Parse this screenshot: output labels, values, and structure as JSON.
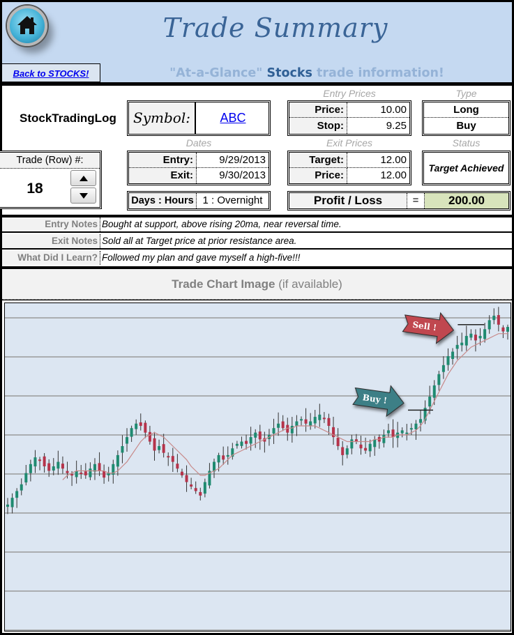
{
  "header": {
    "title": "Trade Summary",
    "back_link": "Back to STOCKS!",
    "subtitle_part1": "\"At-a-Glance\" ",
    "subtitle_part2": "Stocks",
    "subtitle_part3": " trade information!",
    "home_icon": "home-icon"
  },
  "brand": "StockTradingLog",
  "trade_row": {
    "label": "Trade (Row) #:",
    "value": "18",
    "up_icon": "triangle-up-icon",
    "down_icon": "triangle-down-icon"
  },
  "symbol": {
    "label": "Symbol:",
    "value": "ABC"
  },
  "dates": {
    "heading": "Dates",
    "entry_label": "Entry:",
    "entry_value": "9/29/2013",
    "exit_label": "Exit:",
    "exit_value": "9/30/2013"
  },
  "duration": {
    "label": "Days : Hours",
    "value": "1 : Overnight"
  },
  "entry_prices": {
    "heading": "Entry Prices",
    "price_label": "Price:",
    "price_value": "10.00",
    "stop_label": "Stop:",
    "stop_value": "9.25"
  },
  "exit_prices": {
    "heading": "Exit Prices",
    "target_label": "Target:",
    "target_value": "12.00",
    "price_label": "Price:",
    "price_value": "12.00"
  },
  "type": {
    "heading": "Type",
    "direction": "Long",
    "action": "Buy"
  },
  "status": {
    "heading": "Status",
    "value": "Target Achieved"
  },
  "profit_loss": {
    "label": "Profit / Loss",
    "equals": "=",
    "value": "200.00"
  },
  "notes": [
    {
      "label": "Entry Notes",
      "value": "Bought at support, above rising 20ma, near reversal time."
    },
    {
      "label": "Exit Notes",
      "value": "Sold all at Target price at prior resistance area."
    },
    {
      "label": "What Did I Learn?",
      "value": "Followed my plan and gave myself a high-five!!!"
    }
  ],
  "chart_section": {
    "title_bold": "Trade Chart Image",
    "title_rest": " (if available)"
  },
  "colors": {
    "header_bg": "#c5d9f1",
    "profit_bg": "#d8e4bc",
    "chart_bg": "#dce6f2",
    "candle_up": "#1f8a70",
    "candle_down": "#b5334a",
    "ma_line": "#c88a8a",
    "buy_arrow": "#3d7f86",
    "sell_arrow": "#c0474f"
  },
  "chart_annotations": {
    "buy_label": "Buy !",
    "sell_label": "Sell !"
  },
  "chart_data": {
    "type": "candlestick",
    "title": "",
    "xlabel": "",
    "ylabel": "",
    "gridlines": 9,
    "close_path": [
      20,
      23,
      26,
      29,
      34,
      38,
      41,
      40,
      37,
      35,
      37,
      39,
      36,
      34,
      33,
      35,
      34,
      33,
      36,
      38,
      35,
      32,
      34,
      38,
      42,
      46,
      50,
      54,
      56,
      55,
      52,
      48,
      44,
      46,
      43,
      41,
      39,
      36,
      33,
      30,
      28,
      26,
      24,
      30,
      35,
      39,
      42,
      40,
      42,
      45,
      47,
      48,
      47,
      50,
      52,
      49,
      48,
      51,
      54,
      56,
      54,
      52,
      55,
      57,
      58,
      56,
      57,
      59,
      60,
      58,
      55,
      50,
      46,
      42,
      45,
      49,
      48,
      45,
      44,
      47,
      49,
      48,
      51,
      53,
      50,
      52,
      53,
      52,
      54,
      56,
      58,
      63,
      68,
      73,
      78,
      82,
      86,
      88,
      91,
      92,
      95,
      96,
      93,
      95,
      98,
      102,
      104,
      100,
      97,
      99
    ],
    "ma_path": [
      null,
      null,
      null,
      null,
      null,
      null,
      null,
      null,
      null,
      null,
      null,
      null,
      31,
      33,
      34,
      35,
      35,
      35,
      35,
      35,
      35,
      35,
      34,
      34,
      35,
      37,
      39,
      42,
      45,
      48,
      50,
      51,
      52,
      51,
      50,
      48,
      46,
      44,
      42,
      40,
      37,
      35,
      33,
      33,
      34,
      35,
      36,
      38,
      40,
      42,
      43,
      44,
      45,
      46,
      47,
      48,
      49,
      50,
      51,
      52,
      53,
      54,
      54,
      55,
      55,
      55,
      55,
      55,
      54,
      53,
      52,
      51,
      50,
      49,
      48,
      48,
      48,
      48,
      48,
      48,
      49,
      49,
      50,
      50,
      50,
      51,
      51,
      51,
      52,
      53,
      55,
      58,
      62,
      66,
      70,
      74,
      78,
      81,
      84,
      86,
      88,
      90,
      91,
      92,
      93,
      94,
      95,
      96,
      96,
      96
    ],
    "buy_index": 90,
    "sell_index": 101
  }
}
